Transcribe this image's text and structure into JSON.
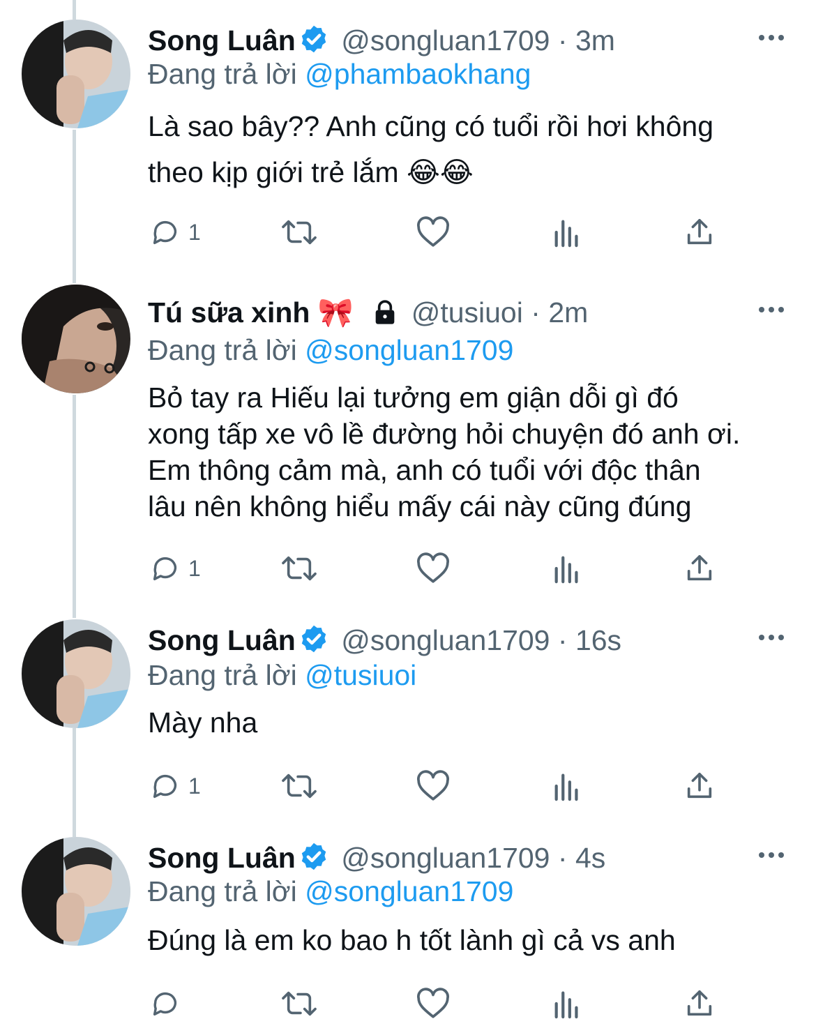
{
  "thread": [
    {
      "name": "Song Luân",
      "verified": true,
      "handle": "@songluan1709",
      "sep": "·",
      "time": "3m",
      "reply_prefix": "Đang trả lời",
      "reply_to": "@phambaokhang",
      "text_lines": [
        "Là sao bây?? Anh cũng có tuổi rồi hơi không",
        "theo kịp giới trẻ lắm 😂😂"
      ],
      "reply_count": "1"
    },
    {
      "name": "Tú sữa xinh 🎀",
      "verified": false,
      "locked": true,
      "handle": "@tusiuoi",
      "sep": "·",
      "time": "2m",
      "reply_prefix": "Đang trả lời",
      "reply_to": "@songluan1709",
      "text_lines": [
        "Bỏ tay ra Hiếu lại tưởng em giận dỗi gì đó",
        "xong tấp xe vô lề đường hỏi chuyện đó anh ơi.",
        "Em thông cảm mà, anh có tuổi với độc thân",
        "lâu nên không hiểu mấy cái này cũng đúng"
      ],
      "reply_count": "1"
    },
    {
      "name": "Song Luân",
      "verified": true,
      "handle": "@songluan1709",
      "sep": "·",
      "time": "16s",
      "reply_prefix": "Đang trả lời",
      "reply_to": "@tusiuoi",
      "text_lines": [
        "Mày nha"
      ],
      "reply_count": "1"
    },
    {
      "name": "Song Luân",
      "verified": true,
      "handle": "@songluan1709",
      "sep": "·",
      "time": "4s",
      "reply_prefix": "Đang trả lời",
      "reply_to": "@songluan1709",
      "text_lines": [
        "Đúng là em ko bao h tốt lành gì cả vs anh"
      ],
      "reply_count": ""
    }
  ],
  "colors": {
    "accent": "#1d9bf0",
    "secondary_text": "#536471",
    "primary_text": "#0f1419",
    "thread_line": "#cfd9de"
  },
  "icons": {
    "reply": "reply-icon",
    "retweet": "retweet-icon",
    "like": "heart-icon",
    "views": "analytics-icon",
    "share": "share-icon",
    "more": "more-icon",
    "verified": "verified-badge-icon",
    "lock": "lock-icon"
  }
}
